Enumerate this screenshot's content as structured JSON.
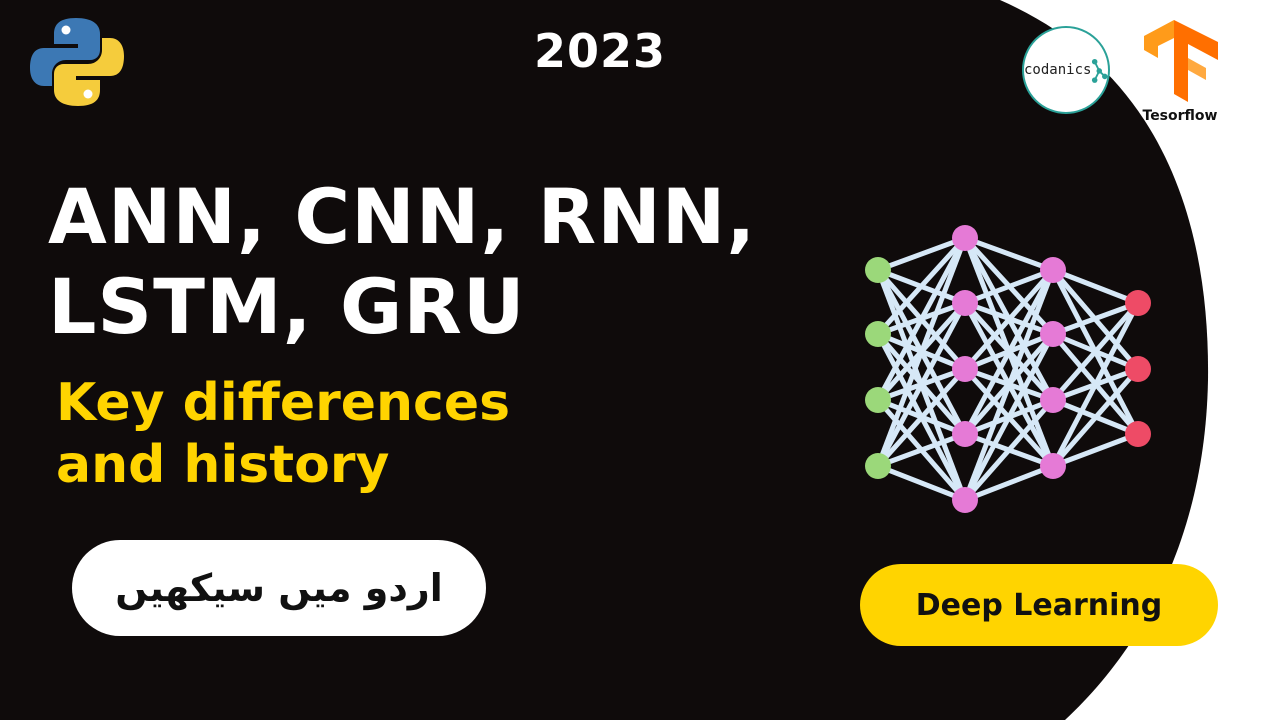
{
  "year": "2023",
  "headline": {
    "line1": "ANN, CNN, RNN,",
    "line2": "LSTM, GRU"
  },
  "subtitle": {
    "line1": "Key differences",
    "line2": "and history"
  },
  "urdu_badge": "اردو میں سیکھیں",
  "deep_learning_badge": "Deep Learning",
  "logos": {
    "codanics": "codanics",
    "tensorflow_caption": "Tesorflow"
  },
  "colors": {
    "background": "#0f0b0b",
    "accent_yellow": "#ffd400",
    "input_node": "#9bd87a",
    "hidden_node": "#e57ad6",
    "output_node": "#ee4b66",
    "edge": "#d6e8f7"
  },
  "icons": [
    "python-logo-icon",
    "codanics-logo-icon",
    "tensorflow-logo-icon",
    "neural-network-icon"
  ]
}
